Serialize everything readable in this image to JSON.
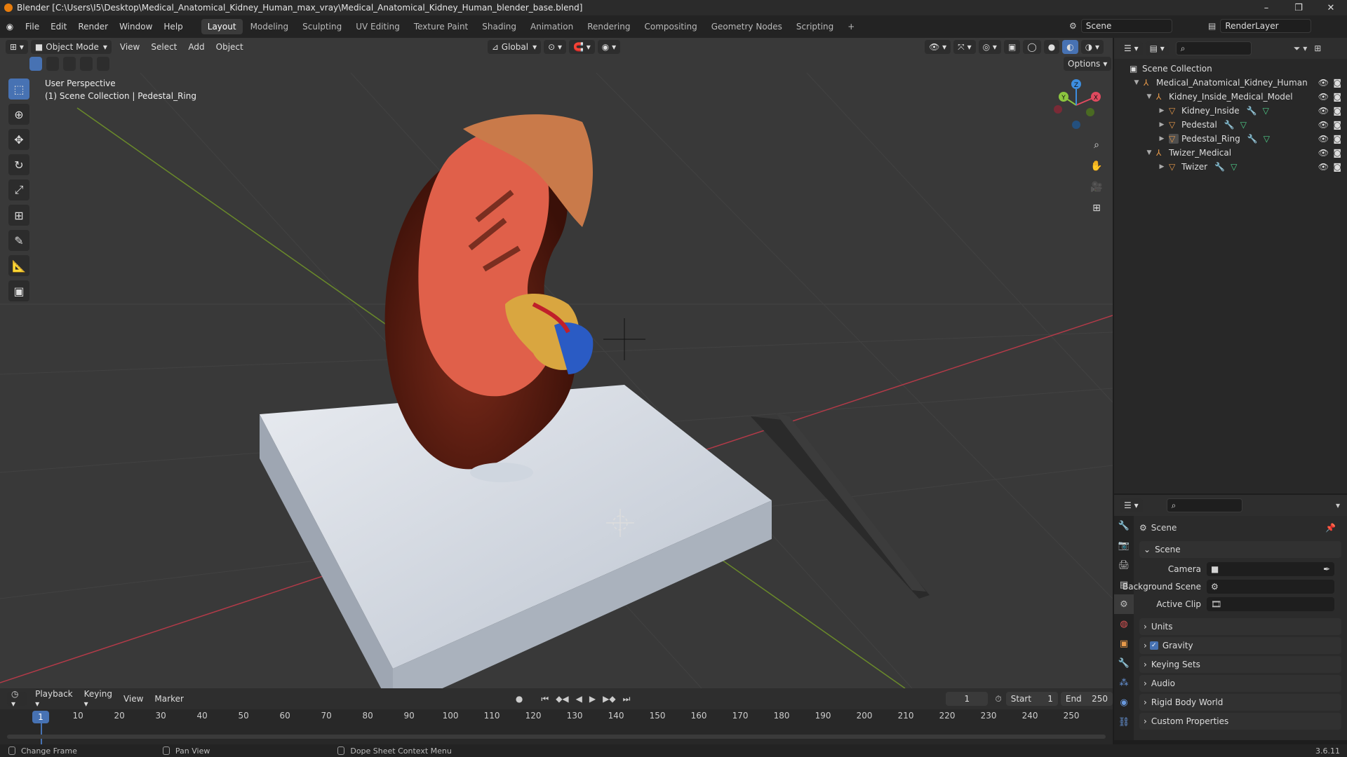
{
  "title_bar": {
    "title": "Blender [C:\\Users\\I5\\Desktop\\Medical_Anatomical_Kidney_Human_max_vray\\Medical_Anatomical_Kidney_Human_blender_base.blend]",
    "minimize": "–",
    "maximize": "❐",
    "close": "✕"
  },
  "menu": {
    "items": [
      "File",
      "Edit",
      "Render",
      "Window",
      "Help"
    ],
    "workspaces": [
      "Layout",
      "Modeling",
      "Sculpting",
      "UV Editing",
      "Texture Paint",
      "Shading",
      "Animation",
      "Rendering",
      "Compositing",
      "Geometry Nodes",
      "Scripting"
    ],
    "active_workspace": "Layout",
    "add_workspace": "+",
    "scene_name": "Scene",
    "view_layer": "RenderLayer"
  },
  "viewport": {
    "mode": "Object Mode",
    "menus": [
      "View",
      "Select",
      "Add",
      "Object"
    ],
    "transform_orientation": "Global",
    "options_label": "Options",
    "overlay_line1": "User Perspective",
    "overlay_line2": "(1) Scene Collection | Pedestal_Ring",
    "gizmo": {
      "x": "X",
      "y": "Y",
      "z": "Z"
    }
  },
  "outliner": {
    "root": "Scene Collection",
    "items": [
      {
        "label": "Medical_Anatomical_Kidney_Human",
        "type": "empty"
      },
      {
        "label": "Kidney_Inside_Medical_Model",
        "type": "empty"
      },
      {
        "label": "Kidney_Inside",
        "type": "mesh"
      },
      {
        "label": "Pedestal",
        "type": "mesh"
      },
      {
        "label": "Pedestal_Ring",
        "type": "mesh"
      },
      {
        "label": "Twizer_Medical",
        "type": "empty"
      },
      {
        "label": "Twizer",
        "type": "mesh"
      }
    ]
  },
  "properties": {
    "context": "Scene",
    "panel_title": "Scene",
    "camera_label": "Camera",
    "background_scene_label": "Background Scene",
    "active_clip_label": "Active Clip",
    "panels": [
      "Units",
      "Gravity",
      "Keying Sets",
      "Audio",
      "Rigid Body World",
      "Custom Properties"
    ],
    "gravity_checked": true
  },
  "timeline": {
    "menus": [
      "Playback",
      "Keying",
      "View",
      "Marker"
    ],
    "current_frame": "1",
    "start_label": "Start",
    "start": "1",
    "end_label": "End",
    "end": "250",
    "ruler": [
      "10",
      "20",
      "30",
      "40",
      "50",
      "60",
      "70",
      "80",
      "90",
      "100",
      "110",
      "120",
      "130",
      "140",
      "150",
      "160",
      "170",
      "180",
      "190",
      "200",
      "210",
      "220",
      "230",
      "240",
      "250"
    ],
    "playhead": "1"
  },
  "status_bar": {
    "left": "Change Frame",
    "middle": "Pan View",
    "right": "Dope Sheet Context Menu",
    "version": "3.6.11"
  },
  "colors": {
    "accent": "#4772b3",
    "axis_x": "#e04a5f",
    "axis_y": "#8cc63f",
    "axis_z": "#3d8ee0"
  }
}
